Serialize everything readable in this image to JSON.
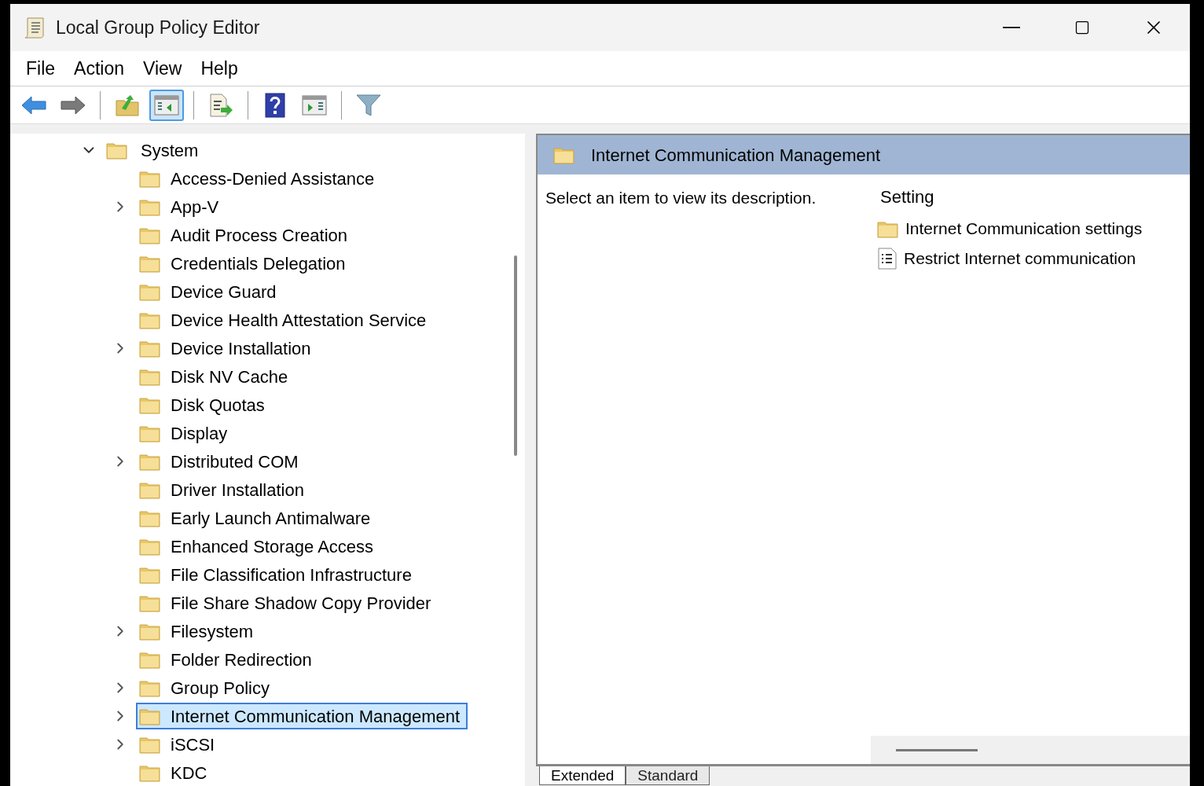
{
  "window": {
    "title": "Local Group Policy Editor"
  },
  "menu": [
    "File",
    "Action",
    "View",
    "Help"
  ],
  "toolbar": [
    {
      "kind": "back",
      "pressed": false
    },
    {
      "kind": "forward",
      "pressed": false
    },
    {
      "kind": "sep"
    },
    {
      "kind": "up",
      "pressed": false
    },
    {
      "kind": "tree",
      "pressed": true
    },
    {
      "kind": "sep"
    },
    {
      "kind": "export",
      "pressed": false
    },
    {
      "kind": "sep"
    },
    {
      "kind": "help",
      "pressed": false
    },
    {
      "kind": "pane",
      "pressed": false
    },
    {
      "kind": "sep"
    },
    {
      "kind": "filter",
      "pressed": false
    }
  ],
  "tree": [
    {
      "label": "System",
      "expanded": true,
      "children": [
        {
          "label": "Access-Denied Assistance",
          "expandable": false,
          "selected": false
        },
        {
          "label": "App-V",
          "expandable": true,
          "selected": false
        },
        {
          "label": "Audit Process Creation",
          "expandable": false,
          "selected": false
        },
        {
          "label": "Credentials Delegation",
          "expandable": false,
          "selected": false
        },
        {
          "label": "Device Guard",
          "expandable": false,
          "selected": false
        },
        {
          "label": "Device Health Attestation Service",
          "expandable": false,
          "selected": false
        },
        {
          "label": "Device Installation",
          "expandable": true,
          "selected": false
        },
        {
          "label": "Disk NV Cache",
          "expandable": false,
          "selected": false
        },
        {
          "label": "Disk Quotas",
          "expandable": false,
          "selected": false
        },
        {
          "label": "Display",
          "expandable": false,
          "selected": false
        },
        {
          "label": "Distributed COM",
          "expandable": true,
          "selected": false
        },
        {
          "label": "Driver Installation",
          "expandable": false,
          "selected": false
        },
        {
          "label": "Early Launch Antimalware",
          "expandable": false,
          "selected": false
        },
        {
          "label": "Enhanced Storage Access",
          "expandable": false,
          "selected": false
        },
        {
          "label": "File Classification Infrastructure",
          "expandable": false,
          "selected": false
        },
        {
          "label": "File Share Shadow Copy Provider",
          "expandable": false,
          "selected": false
        },
        {
          "label": "Filesystem",
          "expandable": true,
          "selected": false
        },
        {
          "label": "Folder Redirection",
          "expandable": false,
          "selected": false
        },
        {
          "label": "Group Policy",
          "expandable": true,
          "selected": false
        },
        {
          "label": "Internet Communication Management",
          "expandable": true,
          "selected": true
        },
        {
          "label": "iSCSI",
          "expandable": true,
          "selected": false
        },
        {
          "label": "KDC",
          "expandable": false,
          "selected": false
        }
      ]
    }
  ],
  "details": {
    "header": "Internet Communication Management",
    "description": "Select an item to view its description.",
    "column": "Setting",
    "items": [
      {
        "kind": "folder",
        "label": "Internet Communication settings"
      },
      {
        "kind": "policy",
        "label": "Restrict Internet communication"
      }
    ]
  },
  "tabs": [
    {
      "label": "Extended",
      "selected": true
    },
    {
      "label": "Standard",
      "selected": false
    }
  ]
}
